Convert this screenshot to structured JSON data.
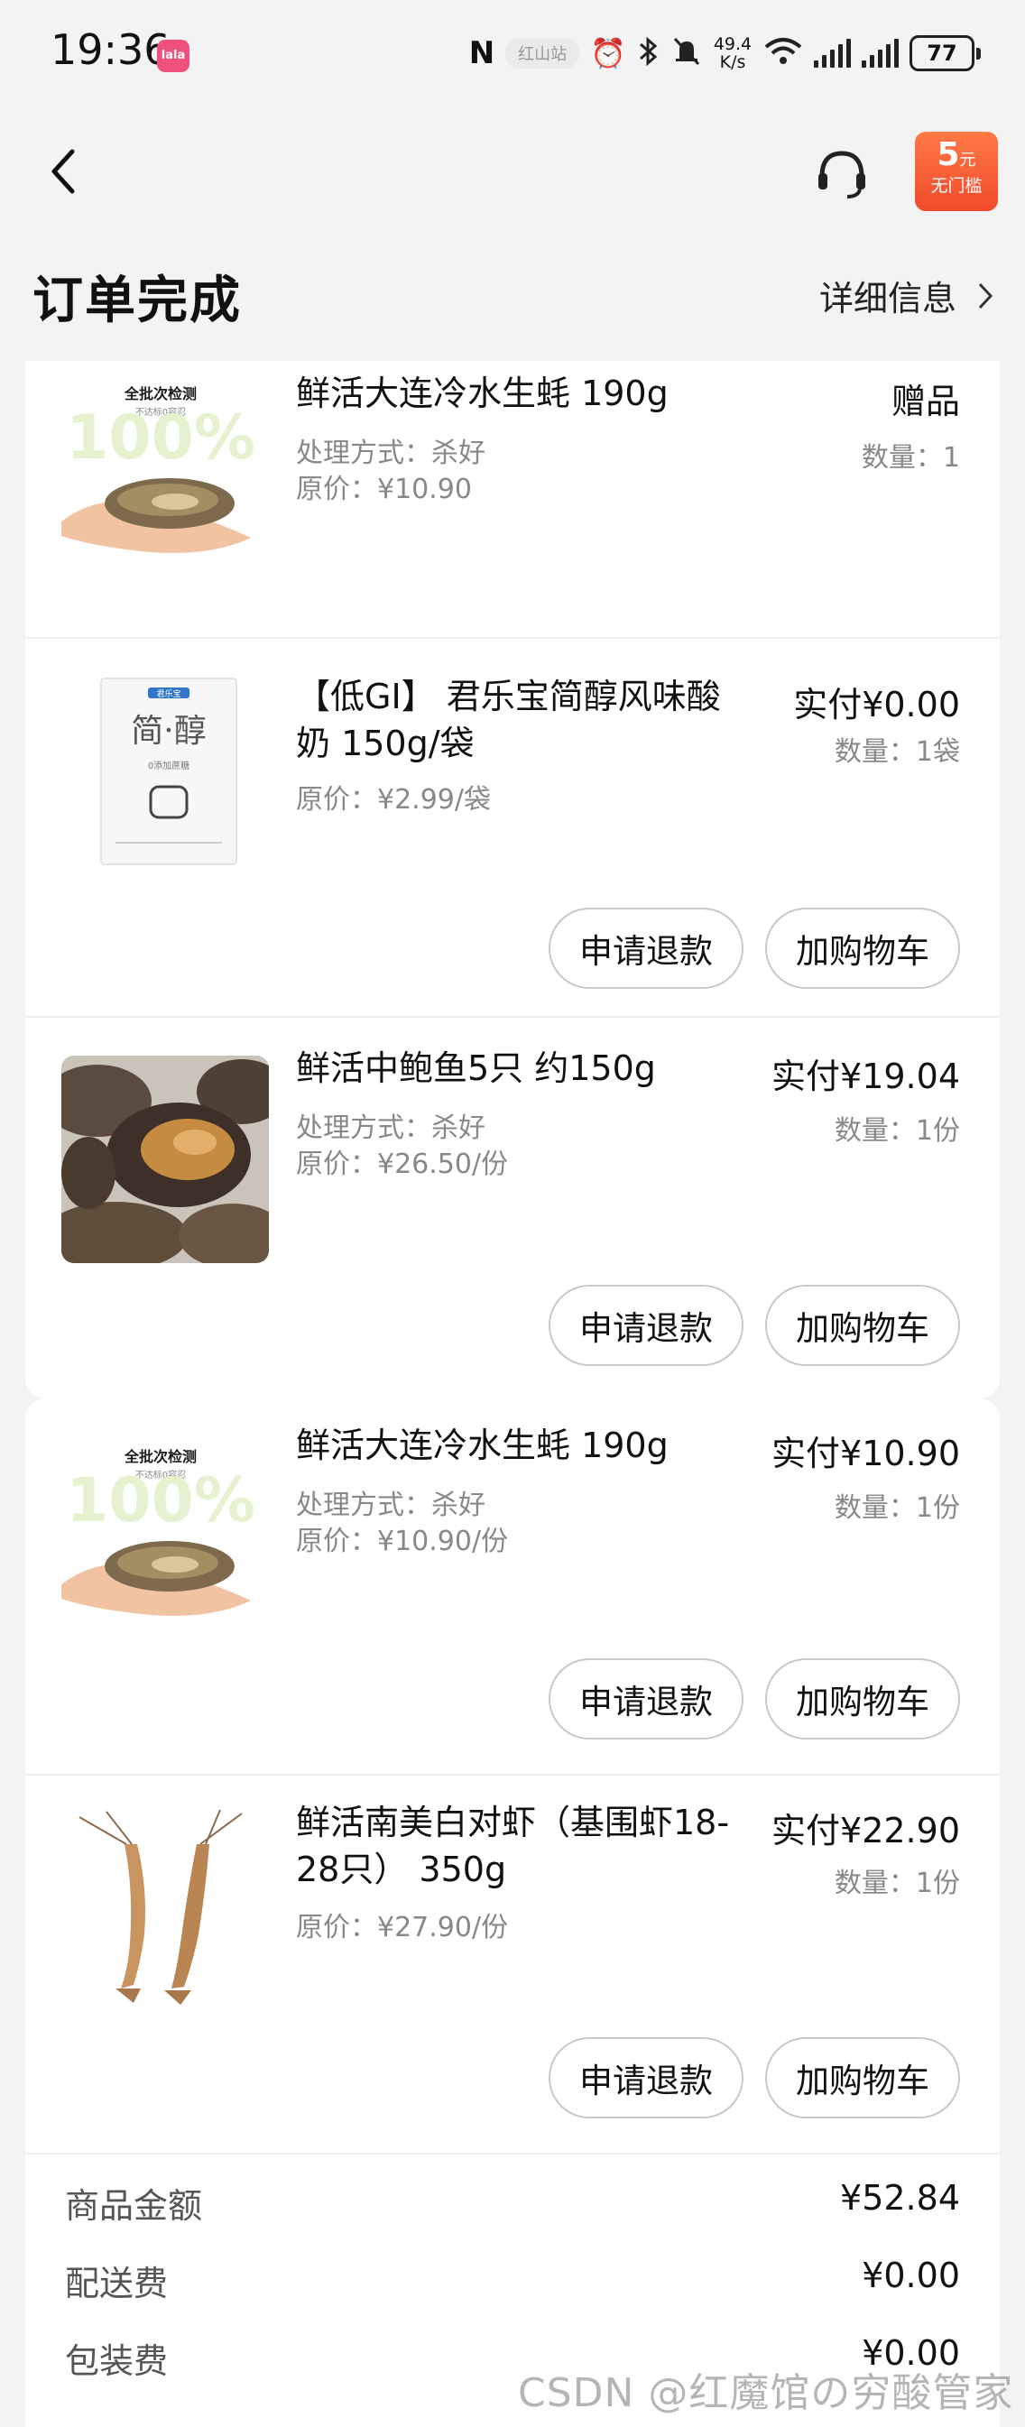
{
  "status_bar": {
    "time": "19:36",
    "app_badge": "lala",
    "nfc": "N",
    "carrier": "红山站",
    "speed": "49.4\nK/s",
    "battery": "77"
  },
  "nav": {
    "coupon_amount": "5",
    "coupon_unit": "元",
    "coupon_text": "无门槛"
  },
  "header": {
    "title": "订单完成",
    "detail_link": "详细信息"
  },
  "card1": {
    "items": [
      {
        "name": "鲜活大连冷水生蚝 190g",
        "meta1": "处理方式：杀好",
        "meta2": "原价：¥10.90",
        "price": "赠品",
        "qty": "数量：1",
        "thumb_banner": "全批次检测",
        "thumb_sub": "不达标0容忍",
        "thumb_big": "100%"
      },
      {
        "name": "【低GI】 君乐宝简醇风味酸奶 150g/袋",
        "meta1": "原价：¥2.99/袋",
        "price": "实付¥0.00",
        "qty": "数量：1袋",
        "pkg_brand": "君乐宝",
        "pkg_title": "简·醇",
        "pkg_sub": "0添加蔗糖",
        "refund_label": "申请退款",
        "cart_label": "加购物车"
      },
      {
        "name": "鲜活中鲍鱼5只 约150g",
        "meta1": "处理方式：杀好",
        "meta2": "原价：¥26.50/份",
        "price": "实付¥19.04",
        "qty": "数量：1份",
        "refund_label": "申请退款",
        "cart_label": "加购物车"
      }
    ]
  },
  "card2": {
    "items": [
      {
        "name": "鲜活大连冷水生蚝 190g",
        "meta1": "处理方式：杀好",
        "meta2": "原价：¥10.90/份",
        "price": "实付¥10.90",
        "qty": "数量：1份",
        "thumb_banner": "全批次检测",
        "thumb_sub": "不达标0容忍",
        "thumb_big": "100%",
        "refund_label": "申请退款",
        "cart_label": "加购物车"
      },
      {
        "name": "鲜活南美白对虾（基围虾18-28只） 350g",
        "meta1": "原价：¥27.90/份",
        "price": "实付¥22.90",
        "qty": "数量：1份",
        "refund_label": "申请退款",
        "cart_label": "加购物车"
      }
    ],
    "summary": [
      {
        "label": "商品金额",
        "value": "¥52.84"
      },
      {
        "label": "配送费",
        "value": "¥0.00"
      },
      {
        "label": "包装费",
        "value": "¥0.00"
      }
    ]
  },
  "watermark": "CSDN @红魔馆の穷酸管家"
}
